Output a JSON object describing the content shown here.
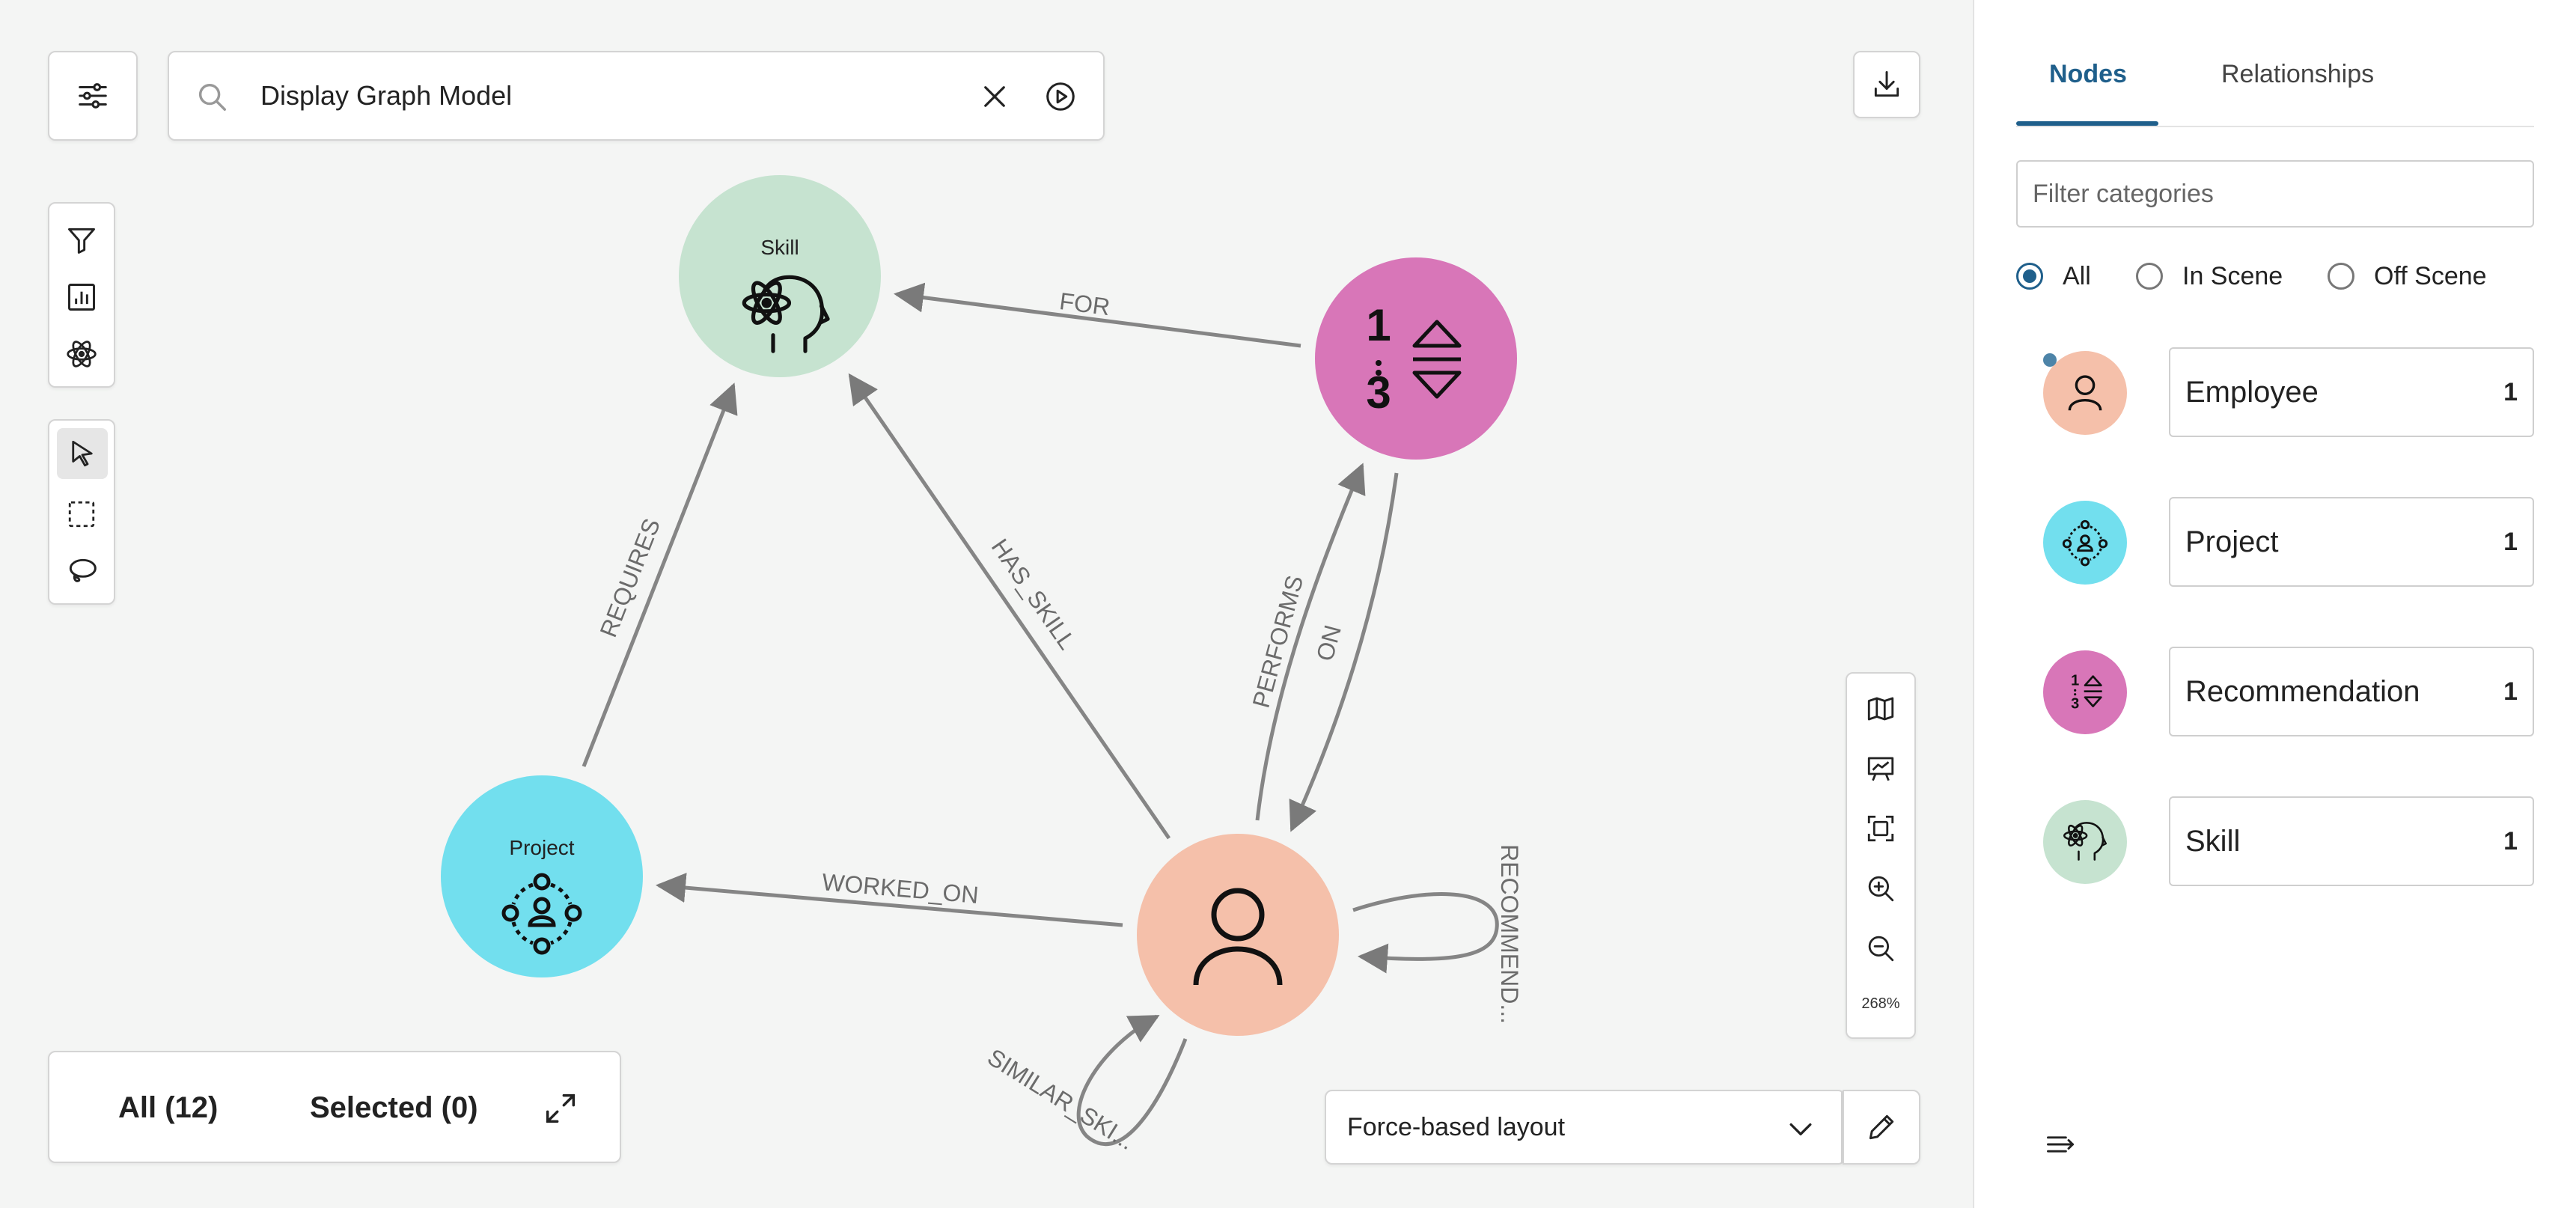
{
  "search": {
    "value": "Display Graph Model"
  },
  "graph": {
    "nodes": [
      {
        "id": "skill",
        "title": "Skill",
        "color": "#c6e3d0",
        "icon": "atom-head-icon"
      },
      {
        "id": "recommendation",
        "title": "",
        "color": "#d876b8",
        "icon": "sort-ranking-icon"
      },
      {
        "id": "project",
        "title": "Project",
        "color": "#72dfee",
        "icon": "team-network-icon"
      },
      {
        "id": "employee",
        "title": "",
        "color": "#f5c0aa",
        "icon": "person-icon"
      }
    ],
    "edges": [
      {
        "label": "FOR"
      },
      {
        "label": "REQUIRES"
      },
      {
        "label": "HAS_SKILL"
      },
      {
        "label": "PERFORMS"
      },
      {
        "label": "ON"
      },
      {
        "label": "WORKED_ON"
      },
      {
        "label": "RECOMMEND..."
      },
      {
        "label": "SIMILAR_SKI..."
      }
    ]
  },
  "bottom_bar": {
    "all_label": "All (12)",
    "selected_label": "Selected (0)"
  },
  "layout": {
    "label": "Force-based layout"
  },
  "zoom": {
    "level": "268%"
  },
  "panel": {
    "tabs": [
      {
        "label": "Nodes",
        "active": true
      },
      {
        "label": "Relationships",
        "active": false
      }
    ],
    "filter_placeholder": "Filter categories",
    "radios": [
      {
        "label": "All",
        "checked": true
      },
      {
        "label": "In Scene",
        "checked": false
      },
      {
        "label": "Off Scene",
        "checked": false
      }
    ],
    "categories": [
      {
        "name": "Employee",
        "count": "1",
        "color": "#f5c0aa",
        "icon": "person-icon"
      },
      {
        "name": "Project",
        "count": "1",
        "color": "#72dfee",
        "icon": "team-network-icon"
      },
      {
        "name": "Recommendation",
        "count": "1",
        "color": "#d876b8",
        "icon": "sort-ranking-icon"
      },
      {
        "name": "Skill",
        "count": "1",
        "color": "#c6e3d0",
        "icon": "atom-head-icon"
      }
    ]
  }
}
